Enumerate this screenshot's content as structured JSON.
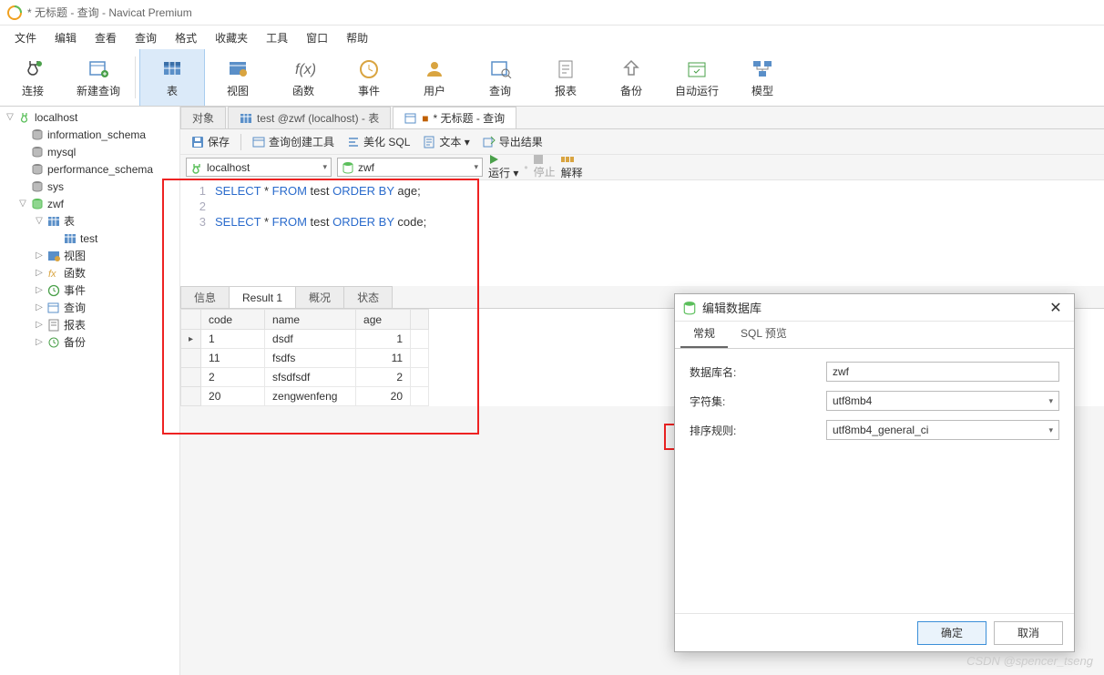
{
  "window": {
    "title": "* 无标题 - 查询 - Navicat Premium"
  },
  "menu": [
    "文件",
    "编辑",
    "查看",
    "查询",
    "格式",
    "收藏夹",
    "工具",
    "窗口",
    "帮助"
  ],
  "toolbar": [
    {
      "label": "连接",
      "icon": "plug"
    },
    {
      "label": "新建查询",
      "icon": "newquery"
    },
    {
      "sep": true
    },
    {
      "label": "表",
      "icon": "table",
      "active": true
    },
    {
      "label": "视图",
      "icon": "view"
    },
    {
      "label": "函数",
      "icon": "fx"
    },
    {
      "label": "事件",
      "icon": "clock"
    },
    {
      "label": "用户",
      "icon": "user"
    },
    {
      "label": "查询",
      "icon": "query"
    },
    {
      "label": "报表",
      "icon": "report"
    },
    {
      "label": "备份",
      "icon": "backup"
    },
    {
      "label": "自动运行",
      "icon": "schedule"
    },
    {
      "label": "模型",
      "icon": "model"
    }
  ],
  "tree": {
    "root": "localhost",
    "dbs": [
      {
        "name": "information_schema",
        "open": false
      },
      {
        "name": "mysql",
        "open": false
      },
      {
        "name": "performance_schema",
        "open": false
      },
      {
        "name": "sys",
        "open": false
      },
      {
        "name": "zwf",
        "open": true,
        "children": [
          {
            "type": "group",
            "name": "表",
            "icon": "table",
            "open": true,
            "children": [
              {
                "name": "test",
                "icon": "table"
              }
            ]
          },
          {
            "type": "group",
            "name": "视图",
            "icon": "view"
          },
          {
            "type": "group",
            "name": "函数",
            "icon": "fx"
          },
          {
            "type": "group",
            "name": "事件",
            "icon": "clock"
          },
          {
            "type": "group",
            "name": "查询",
            "icon": "query"
          },
          {
            "type": "group",
            "name": "报表",
            "icon": "report"
          },
          {
            "type": "group",
            "name": "备份",
            "icon": "backup"
          }
        ]
      }
    ]
  },
  "tabs": [
    {
      "label": "对象",
      "icon": null
    },
    {
      "label": "test @zwf (localhost) - 表",
      "icon": "table"
    },
    {
      "label": "* 无标题 - 查询",
      "icon": "query",
      "dirty": true,
      "active": true
    }
  ],
  "subtoolbar": {
    "save": "保存",
    "builder": "查询创建工具",
    "beautify": "美化 SQL",
    "text": "文本 ▾",
    "export": "导出结果"
  },
  "runbar": {
    "conn": "localhost",
    "db": "zwf",
    "run": "运行 ▾",
    "stop": "停止",
    "explain": "解释"
  },
  "sql_lines": [
    {
      "n": 1,
      "tokens": [
        {
          "t": "SELECT",
          "c": "kw"
        },
        {
          "t": " * ",
          "c": ""
        },
        {
          "t": "FROM",
          "c": "kw"
        },
        {
          "t": " test ",
          "c": "ident"
        },
        {
          "t": "ORDER BY",
          "c": "kw"
        },
        {
          "t": " age;",
          "c": "ident"
        }
      ]
    },
    {
      "n": 2,
      "tokens": []
    },
    {
      "n": 3,
      "tokens": [
        {
          "t": "SELECT",
          "c": "kw"
        },
        {
          "t": " * ",
          "c": ""
        },
        {
          "t": "FROM",
          "c": "kw"
        },
        {
          "t": " test ",
          "c": "ident"
        },
        {
          "t": "ORDER BY",
          "c": "kw"
        },
        {
          "t": " code;",
          "c": "ident"
        }
      ]
    }
  ],
  "result_tabs": [
    "信息",
    "Result 1",
    "概况",
    "状态"
  ],
  "result_active": "Result 1",
  "grid": {
    "cols": [
      "code",
      "name",
      "age"
    ],
    "rows": [
      {
        "code": "1",
        "name": "dsdf",
        "age": "1"
      },
      {
        "code": "11",
        "name": "fsdfs",
        "age": "11"
      },
      {
        "code": "2",
        "name": "sfsdfsdf",
        "age": "2"
      },
      {
        "code": "20",
        "name": "zengwenfeng",
        "age": "20"
      }
    ]
  },
  "dialog": {
    "title": "编辑数据库",
    "tabs": [
      "常规",
      "SQL 预览"
    ],
    "tab_active": "常规",
    "fields": {
      "db_label": "数据库名:",
      "db_value": "zwf",
      "charset_label": "字符集:",
      "charset_value": "utf8mb4",
      "collate_label": "排序规则:",
      "collate_value": "utf8mb4_general_ci"
    },
    "ok": "确定",
    "cancel": "取消"
  },
  "watermark": "CSDN @spencer_tseng"
}
